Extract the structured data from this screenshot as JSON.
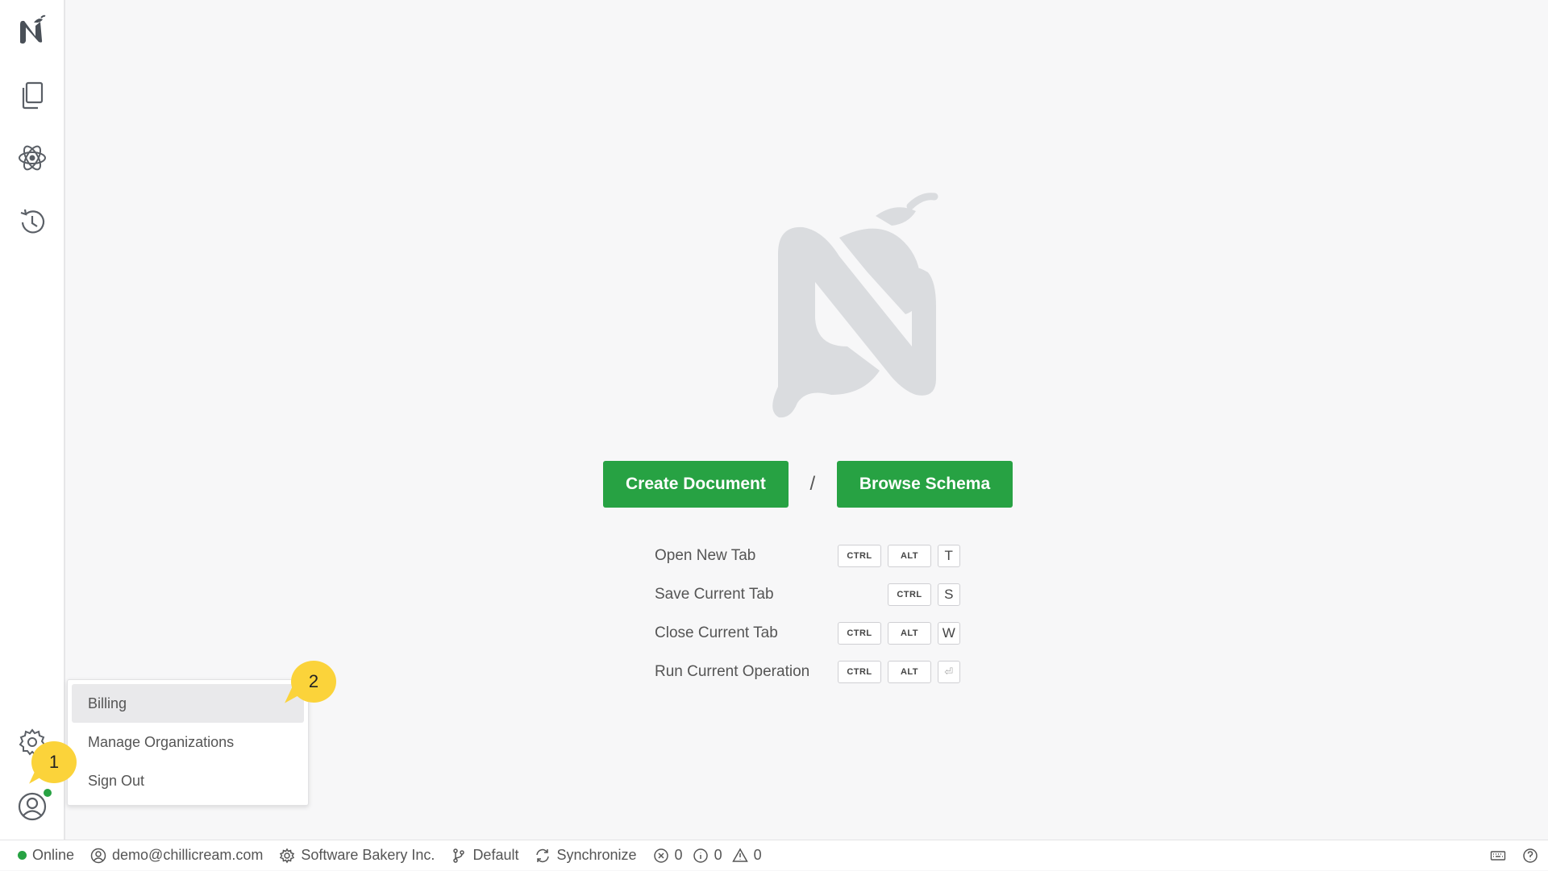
{
  "sidebar": {
    "items": [
      {
        "name": "app-logo",
        "icon": "chili-n-logo-icon"
      },
      {
        "name": "documents",
        "icon": "documents-icon"
      },
      {
        "name": "api",
        "icon": "atom-icon"
      },
      {
        "name": "history",
        "icon": "history-icon"
      },
      {
        "name": "settings",
        "icon": "gear-icon"
      },
      {
        "name": "account",
        "icon": "user-circle-icon"
      }
    ]
  },
  "main": {
    "create_document_label": "Create Document",
    "separator": "/",
    "browse_schema_label": "Browse Schema",
    "shortcuts": [
      {
        "label": "Open New Tab",
        "keys": [
          "CTRL",
          "ALT",
          "T"
        ]
      },
      {
        "label": "Save Current Tab",
        "keys": [
          "CTRL",
          "S"
        ]
      },
      {
        "label": "Close Current Tab",
        "keys": [
          "CTRL",
          "ALT",
          "W"
        ]
      },
      {
        "label": "Run Current Operation",
        "keys": [
          "CTRL",
          "ALT",
          "⏎"
        ]
      }
    ]
  },
  "account_menu": {
    "items": [
      {
        "label": "Billing",
        "active": true
      },
      {
        "label": "Manage Organizations",
        "active": false
      },
      {
        "label": "Sign Out",
        "active": false
      }
    ]
  },
  "badges": {
    "one": "1",
    "two": "2"
  },
  "statusbar": {
    "connection": "Online",
    "email": "demo@chillicream.com",
    "organization": "Software Bakery Inc.",
    "environment": "Default",
    "sync": "Synchronize",
    "errors": "0",
    "infos": "0",
    "warnings": "0"
  },
  "colors": {
    "accent": "#27a243",
    "badge": "#fbd33a",
    "logo": "#d9dbdf",
    "online": "#27a243"
  }
}
